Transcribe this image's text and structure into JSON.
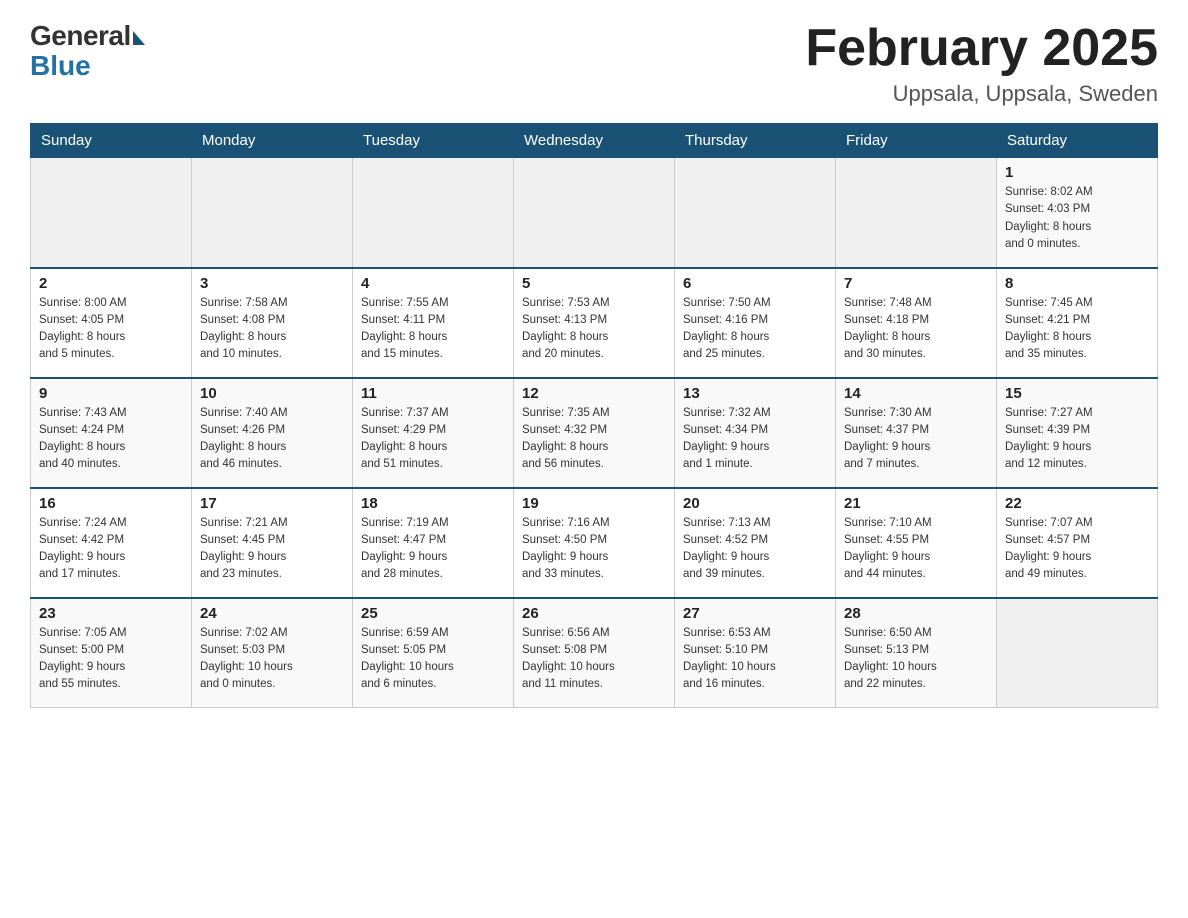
{
  "header": {
    "logo_general": "General",
    "logo_blue": "Blue",
    "month_title": "February 2025",
    "location": "Uppsala, Uppsala, Sweden"
  },
  "days_of_week": [
    "Sunday",
    "Monday",
    "Tuesday",
    "Wednesday",
    "Thursday",
    "Friday",
    "Saturday"
  ],
  "weeks": [
    [
      {
        "day": "",
        "info": ""
      },
      {
        "day": "",
        "info": ""
      },
      {
        "day": "",
        "info": ""
      },
      {
        "day": "",
        "info": ""
      },
      {
        "day": "",
        "info": ""
      },
      {
        "day": "",
        "info": ""
      },
      {
        "day": "1",
        "info": "Sunrise: 8:02 AM\nSunset: 4:03 PM\nDaylight: 8 hours\nand 0 minutes."
      }
    ],
    [
      {
        "day": "2",
        "info": "Sunrise: 8:00 AM\nSunset: 4:05 PM\nDaylight: 8 hours\nand 5 minutes."
      },
      {
        "day": "3",
        "info": "Sunrise: 7:58 AM\nSunset: 4:08 PM\nDaylight: 8 hours\nand 10 minutes."
      },
      {
        "day": "4",
        "info": "Sunrise: 7:55 AM\nSunset: 4:11 PM\nDaylight: 8 hours\nand 15 minutes."
      },
      {
        "day": "5",
        "info": "Sunrise: 7:53 AM\nSunset: 4:13 PM\nDaylight: 8 hours\nand 20 minutes."
      },
      {
        "day": "6",
        "info": "Sunrise: 7:50 AM\nSunset: 4:16 PM\nDaylight: 8 hours\nand 25 minutes."
      },
      {
        "day": "7",
        "info": "Sunrise: 7:48 AM\nSunset: 4:18 PM\nDaylight: 8 hours\nand 30 minutes."
      },
      {
        "day": "8",
        "info": "Sunrise: 7:45 AM\nSunset: 4:21 PM\nDaylight: 8 hours\nand 35 minutes."
      }
    ],
    [
      {
        "day": "9",
        "info": "Sunrise: 7:43 AM\nSunset: 4:24 PM\nDaylight: 8 hours\nand 40 minutes."
      },
      {
        "day": "10",
        "info": "Sunrise: 7:40 AM\nSunset: 4:26 PM\nDaylight: 8 hours\nand 46 minutes."
      },
      {
        "day": "11",
        "info": "Sunrise: 7:37 AM\nSunset: 4:29 PM\nDaylight: 8 hours\nand 51 minutes."
      },
      {
        "day": "12",
        "info": "Sunrise: 7:35 AM\nSunset: 4:32 PM\nDaylight: 8 hours\nand 56 minutes."
      },
      {
        "day": "13",
        "info": "Sunrise: 7:32 AM\nSunset: 4:34 PM\nDaylight: 9 hours\nand 1 minute."
      },
      {
        "day": "14",
        "info": "Sunrise: 7:30 AM\nSunset: 4:37 PM\nDaylight: 9 hours\nand 7 minutes."
      },
      {
        "day": "15",
        "info": "Sunrise: 7:27 AM\nSunset: 4:39 PM\nDaylight: 9 hours\nand 12 minutes."
      }
    ],
    [
      {
        "day": "16",
        "info": "Sunrise: 7:24 AM\nSunset: 4:42 PM\nDaylight: 9 hours\nand 17 minutes."
      },
      {
        "day": "17",
        "info": "Sunrise: 7:21 AM\nSunset: 4:45 PM\nDaylight: 9 hours\nand 23 minutes."
      },
      {
        "day": "18",
        "info": "Sunrise: 7:19 AM\nSunset: 4:47 PM\nDaylight: 9 hours\nand 28 minutes."
      },
      {
        "day": "19",
        "info": "Sunrise: 7:16 AM\nSunset: 4:50 PM\nDaylight: 9 hours\nand 33 minutes."
      },
      {
        "day": "20",
        "info": "Sunrise: 7:13 AM\nSunset: 4:52 PM\nDaylight: 9 hours\nand 39 minutes."
      },
      {
        "day": "21",
        "info": "Sunrise: 7:10 AM\nSunset: 4:55 PM\nDaylight: 9 hours\nand 44 minutes."
      },
      {
        "day": "22",
        "info": "Sunrise: 7:07 AM\nSunset: 4:57 PM\nDaylight: 9 hours\nand 49 minutes."
      }
    ],
    [
      {
        "day": "23",
        "info": "Sunrise: 7:05 AM\nSunset: 5:00 PM\nDaylight: 9 hours\nand 55 minutes."
      },
      {
        "day": "24",
        "info": "Sunrise: 7:02 AM\nSunset: 5:03 PM\nDaylight: 10 hours\nand 0 minutes."
      },
      {
        "day": "25",
        "info": "Sunrise: 6:59 AM\nSunset: 5:05 PM\nDaylight: 10 hours\nand 6 minutes."
      },
      {
        "day": "26",
        "info": "Sunrise: 6:56 AM\nSunset: 5:08 PM\nDaylight: 10 hours\nand 11 minutes."
      },
      {
        "day": "27",
        "info": "Sunrise: 6:53 AM\nSunset: 5:10 PM\nDaylight: 10 hours\nand 16 minutes."
      },
      {
        "day": "28",
        "info": "Sunrise: 6:50 AM\nSunset: 5:13 PM\nDaylight: 10 hours\nand 22 minutes."
      },
      {
        "day": "",
        "info": ""
      }
    ]
  ]
}
